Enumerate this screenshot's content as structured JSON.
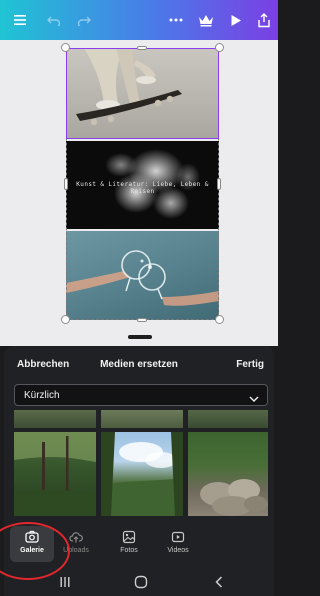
{
  "toolbar": {
    "icons": [
      "menu-icon",
      "undo-icon",
      "redo-icon",
      "more-icon",
      "crown-icon",
      "play-icon",
      "share-icon"
    ],
    "gradient": [
      "#1fc4d4",
      "#4a7be8",
      "#7b3fe4"
    ]
  },
  "canvas": {
    "overlay_text": "Kunst & Literatur: Liebe, Leben & Reisen",
    "selection_color": "#8b3ef0"
  },
  "sheet": {
    "cancel_label": "Abbrechen",
    "title": "Medien ersetzen",
    "done_label": "Fertig",
    "folder_select": {
      "value": "Kürzlich"
    }
  },
  "tabs": [
    {
      "label": "Galerie",
      "icon": "camera-icon",
      "active": true
    },
    {
      "label": "Uploads",
      "icon": "cloud-upload-icon",
      "active": false
    },
    {
      "label": "Fotos",
      "icon": "image-icon",
      "active": false
    },
    {
      "label": "Videos",
      "icon": "video-icon",
      "active": false
    }
  ],
  "system_nav": {
    "icons": [
      "recents-icon",
      "home-icon",
      "back-icon"
    ]
  },
  "annotation": {
    "color": "#e0282d"
  }
}
